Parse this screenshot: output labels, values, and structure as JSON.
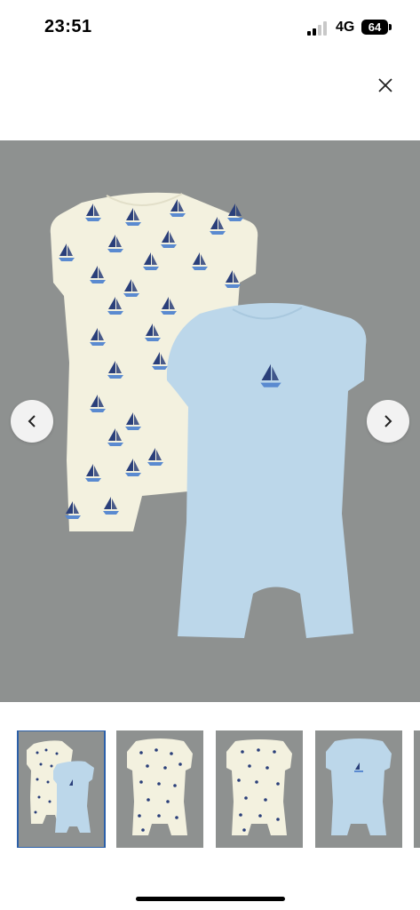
{
  "status_bar": {
    "time": "23:51",
    "network": "4G",
    "battery": "64"
  },
  "icons": {
    "close": "close-icon",
    "prev": "chevron-left-icon",
    "next": "chevron-right-icon"
  },
  "gallery": {
    "background_color": "#8e9190",
    "selected_index": 0,
    "thumbnails": [
      {
        "content": "cream-and-blue-romper-set"
      },
      {
        "content": "cream-sailboat-romper"
      },
      {
        "content": "cream-sailboat-romper-back"
      },
      {
        "content": "blue-romper"
      },
      {
        "content": "partial-thumbnail"
      }
    ]
  },
  "colors": {
    "cream_romper": "#f3f1df",
    "blue_romper": "#bcd7ea",
    "sailboat": "#2a3f7a",
    "selected_outline": "#2b5fa8"
  }
}
